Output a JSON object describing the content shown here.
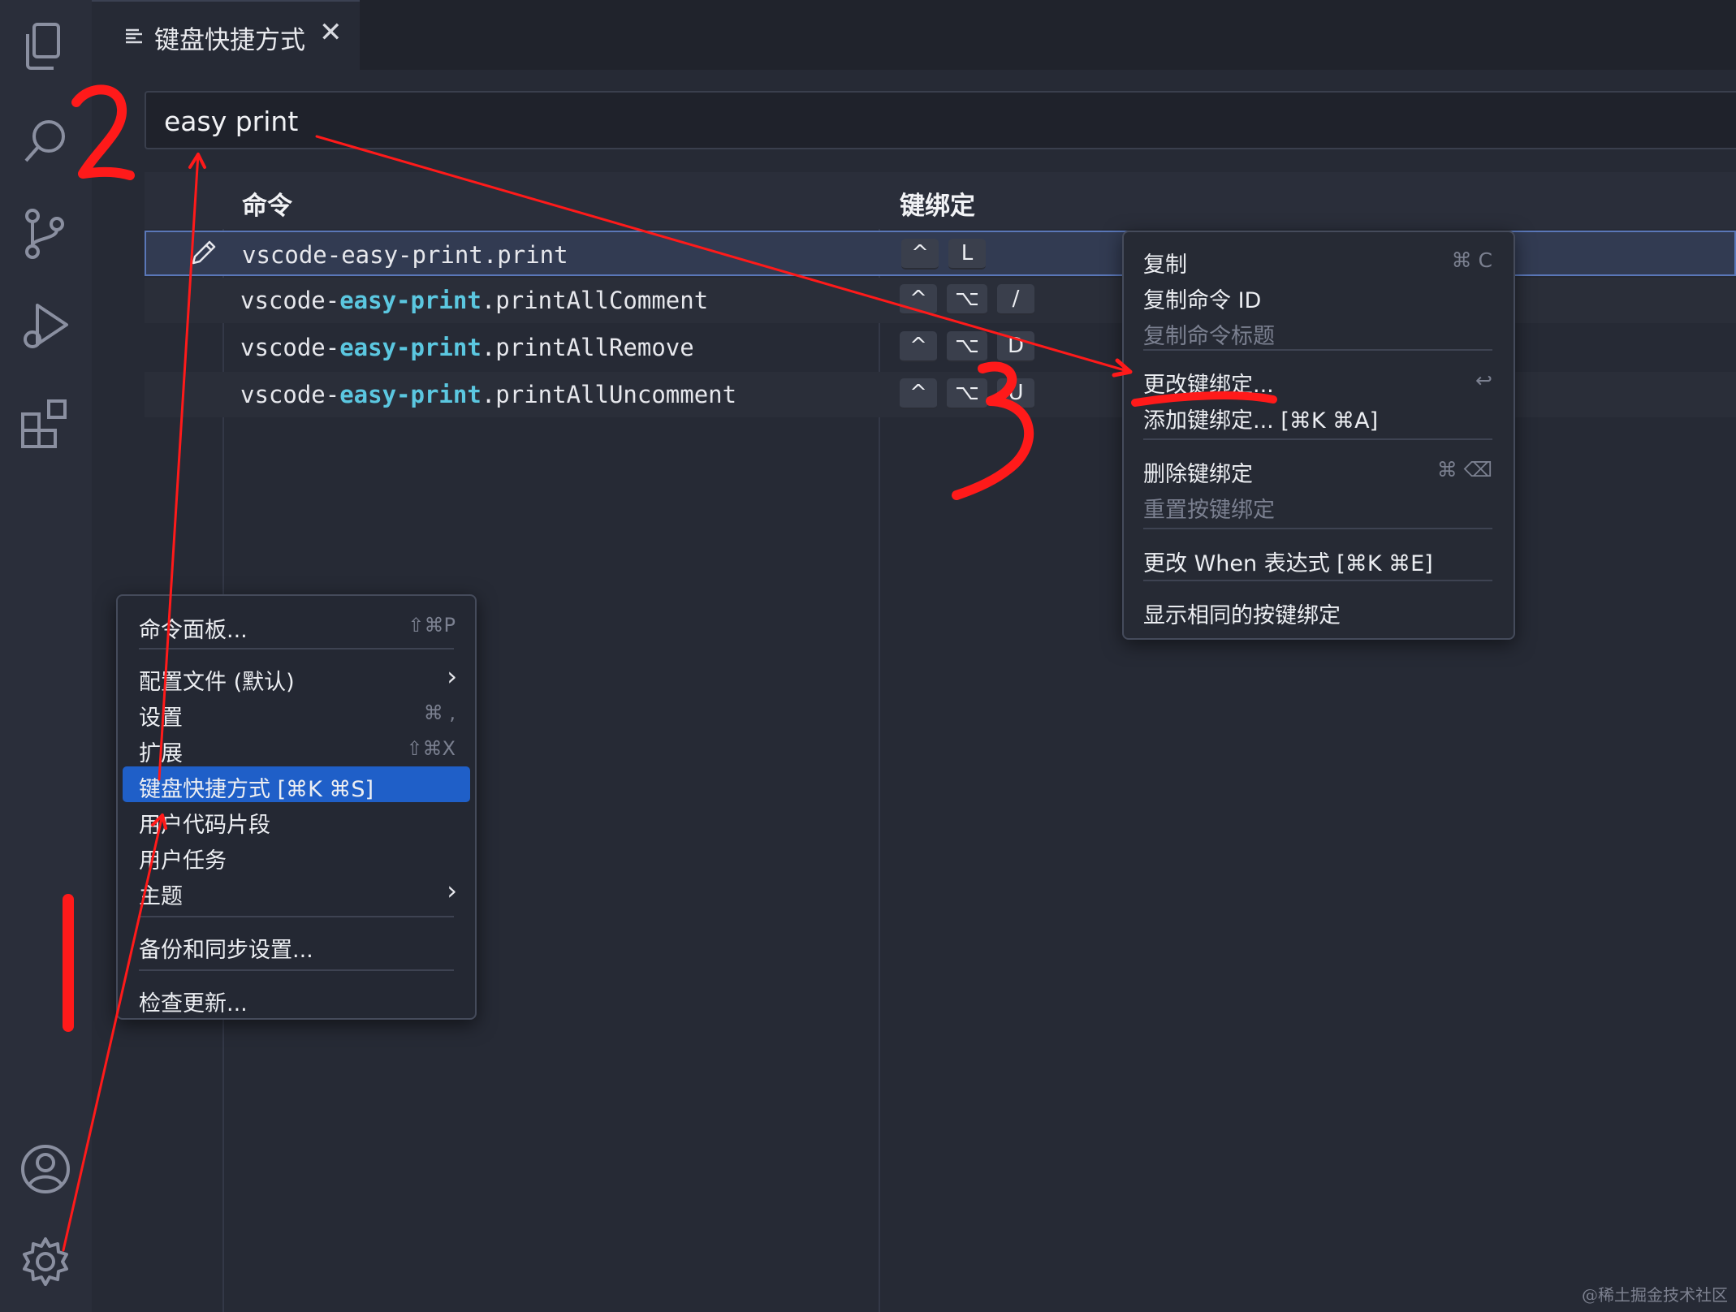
{
  "tab": {
    "label": "键盘快捷方式",
    "icon": "list-icon",
    "close_icon": "close-icon"
  },
  "search": {
    "value": "easy print"
  },
  "table": {
    "headers": {
      "command": "命令",
      "keybinding": "键绑定"
    },
    "rows": [
      {
        "prefix": "vscode-",
        "match": "easy-print",
        "suffix": ".print",
        "keys": [
          "^",
          "L"
        ],
        "selected": true
      },
      {
        "prefix": "vscode-",
        "match": "easy-print",
        "suffix": ".printAllComment",
        "keys": [
          "^",
          "⌥",
          "/"
        ]
      },
      {
        "prefix": "vscode-",
        "match": "easy-print",
        "suffix": ".printAllRemove",
        "keys": [
          "^",
          "⌥",
          "D"
        ]
      },
      {
        "prefix": "vscode-",
        "match": "easy-print",
        "suffix": ".printAllUncomment",
        "keys": [
          "^",
          "⌥",
          "U"
        ]
      }
    ]
  },
  "context_menu": {
    "items": [
      {
        "label": "复制",
        "key": "⌘ C"
      },
      {
        "label": "复制命令 ID",
        "key": ""
      },
      {
        "label": "复制命令标题",
        "key": "",
        "disabled": true
      },
      {
        "label": "更改键绑定...",
        "key": "↩"
      },
      {
        "label": "添加键绑定... [⌘K ⌘A]",
        "key": ""
      },
      {
        "label": "删除键绑定",
        "key": "⌘ ⌫"
      },
      {
        "label": "重置按键绑定",
        "key": "",
        "disabled": true
      },
      {
        "label": "更改 When 表达式 [⌘K ⌘E]",
        "key": ""
      },
      {
        "label": "显示相同的按键绑定",
        "key": ""
      }
    ]
  },
  "manage_menu": {
    "items": [
      {
        "label": "命令面板...",
        "key": "⇧⌘P"
      },
      {
        "label": "配置文件 (默认)",
        "submenu": true
      },
      {
        "label": "设置",
        "key": "⌘ ,"
      },
      {
        "label": "扩展",
        "key": "⇧⌘X"
      },
      {
        "label": "键盘快捷方式 [⌘K ⌘S]",
        "active": true
      },
      {
        "label": "用户代码片段"
      },
      {
        "label": "用户任务"
      },
      {
        "label": "主题",
        "submenu": true
      },
      {
        "label": "备份和同步设置..."
      },
      {
        "label": "检查更新..."
      }
    ]
  },
  "activity_bar": {
    "icons": [
      "explorer-icon",
      "search-icon",
      "source-control-icon",
      "run-debug-icon",
      "extensions-icon",
      "account-icon",
      "manage-gear-icon"
    ]
  },
  "annotations": {
    "step1": "1",
    "step2": "2",
    "step3": "3",
    "color": "#ff1a1a"
  },
  "watermark": "@稀土掘金技术社区",
  "colors": {
    "accent": "#1f5fc8",
    "highlight": "#5bc7e0",
    "annotation": "#ff1a1a"
  }
}
